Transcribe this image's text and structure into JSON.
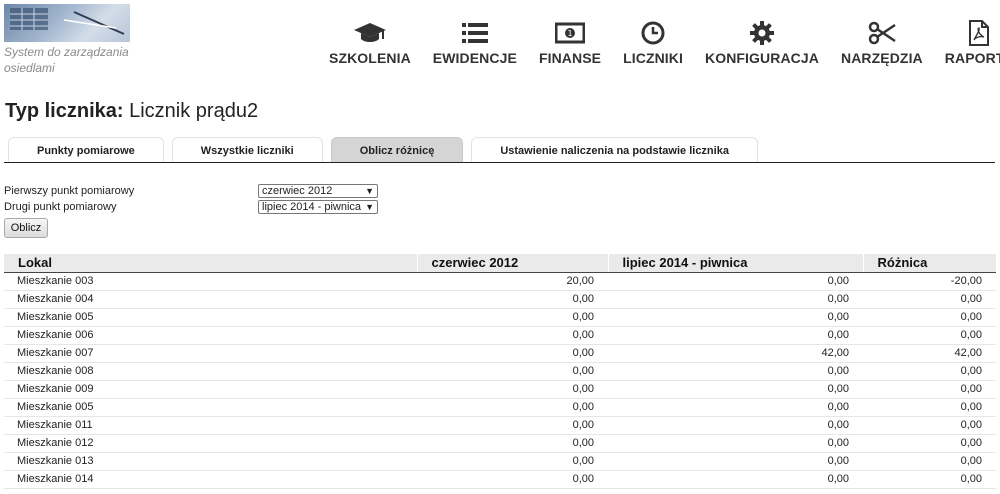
{
  "brand": {
    "tagline": "System do zarządzania osiedlami"
  },
  "nav": [
    {
      "label": "SZKOLENIA",
      "icon": "graduation-cap-icon"
    },
    {
      "label": "EWIDENCJE",
      "icon": "list-icon"
    },
    {
      "label": "FINANSE",
      "icon": "money-icon"
    },
    {
      "label": "LICZNIKI",
      "icon": "clock-icon"
    },
    {
      "label": "KONFIGURACJA",
      "icon": "gear-icon"
    },
    {
      "label": "NARZĘDZIA",
      "icon": "scissors-icon"
    },
    {
      "label": "RAPORTY",
      "icon": "pdf-file-icon"
    }
  ],
  "page": {
    "title_prefix": "Typ licznika:",
    "title_value": "Licznik prądu2"
  },
  "tabs": [
    {
      "label": "Punkty pomiarowe",
      "active": false
    },
    {
      "label": "Wszystkie liczniki",
      "active": false
    },
    {
      "label": "Oblicz różnicę",
      "active": true
    },
    {
      "label": "Ustawienie naliczenia na podstawie licznika",
      "active": false
    }
  ],
  "form": {
    "first_label": "Pierwszy punkt pomiarowy",
    "first_value": "czerwiec 2012",
    "second_label": "Drugi punkt pomiarowy",
    "second_value": "lipiec 2014 - piwnica",
    "submit_label": "Oblicz"
  },
  "table": {
    "headers": [
      "Lokal",
      "czerwiec 2012",
      "lipiec 2014 - piwnica",
      "Różnica"
    ],
    "rows": [
      [
        "Mieszkanie 003",
        "20,00",
        "0,00",
        "-20,00"
      ],
      [
        "Mieszkanie 004",
        "0,00",
        "0,00",
        "0,00"
      ],
      [
        "Mieszkanie 005",
        "0,00",
        "0,00",
        "0,00"
      ],
      [
        "Mieszkanie 006",
        "0,00",
        "0,00",
        "0,00"
      ],
      [
        "Mieszkanie 007",
        "0,00",
        "42,00",
        "42,00"
      ],
      [
        "Mieszkanie 008",
        "0,00",
        "0,00",
        "0,00"
      ],
      [
        "Mieszkanie 009",
        "0,00",
        "0,00",
        "0,00"
      ],
      [
        "Mieszkanie 005",
        "0,00",
        "0,00",
        "0,00"
      ],
      [
        "Mieszkanie 011",
        "0,00",
        "0,00",
        "0,00"
      ],
      [
        "Mieszkanie 012",
        "0,00",
        "0,00",
        "0,00"
      ],
      [
        "Mieszkanie 013",
        "0,00",
        "0,00",
        "0,00"
      ],
      [
        "Mieszkanie 014",
        "0,00",
        "0,00",
        "0,00"
      ]
    ]
  },
  "colors": {
    "negative": "#d00000",
    "icon": "#333333",
    "active_tab": "#d5d5d5"
  }
}
